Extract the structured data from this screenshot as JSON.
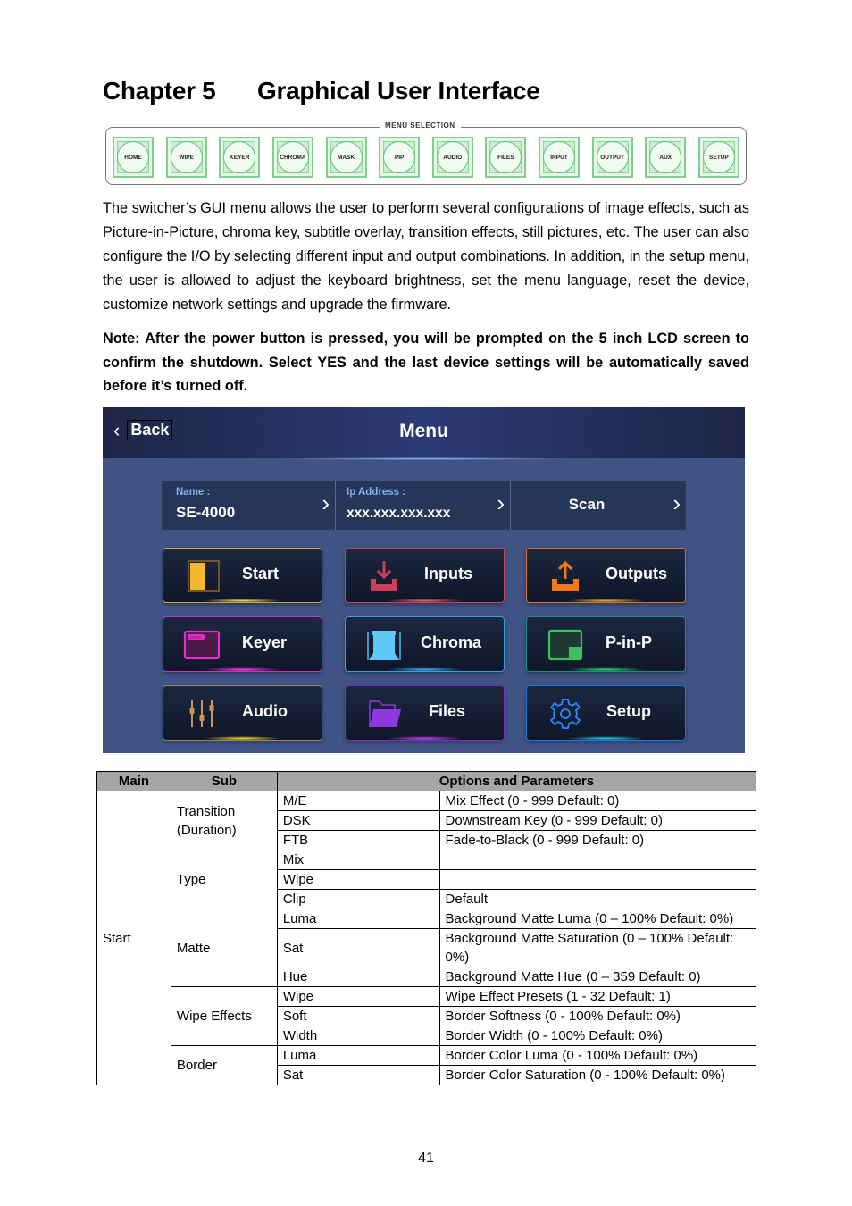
{
  "chapter": {
    "number": "Chapter 5",
    "title": "Graphical User Interface"
  },
  "menu_selection": {
    "label": "MENU SELECTION",
    "keys": [
      "HOME",
      "WIPE",
      "KEYER",
      "CHROMA",
      "MASK",
      "PIP",
      "AUDIO",
      "FILES",
      "INPUT",
      "OUTPUT",
      "AUX",
      "SETUP"
    ]
  },
  "body_text": "The switcher’s GUI menu allows the user to perform several configurations of image effects, such as Picture-in-Picture, chroma key, subtitle overlay, transition effects, still pictures, etc. The user can also configure the I/O by selecting different input and output combinations. In addition, in the setup menu, the user is allowed to adjust the keyboard brightness, set the menu language, reset the device, customize network settings and upgrade the firmware.",
  "note_text": "Note: After the power button is pressed, you will be prompted on the 5 inch LCD screen to confirm the shutdown. Select YES and the last device settings will be automatically saved before it’s turned off.",
  "gui": {
    "back_label": "Back",
    "title": "Menu",
    "name_label": "Name :",
    "name_value": "SE-4000",
    "ip_label": "Ip Address :",
    "ip_value": "xxx.xxx.xxx.xxx",
    "scan_label": "Scan",
    "tiles": [
      {
        "label": "Start",
        "icon": "start-icon",
        "color": "#d4a62a"
      },
      {
        "label": "Inputs",
        "icon": "download-icon",
        "color": "#d13e5c"
      },
      {
        "label": "Outputs",
        "icon": "upload-icon",
        "color": "#f07a1a"
      },
      {
        "label": "Keyer",
        "icon": "keyer-logo-icon",
        "color": "#e12fc8"
      },
      {
        "label": "Chroma",
        "icon": "chroma-backdrop-icon",
        "color": "#3aa8e0"
      },
      {
        "label": "P-in-P",
        "icon": "pip-icon",
        "color": "#1fa08a"
      },
      {
        "label": "Audio",
        "icon": "audio-faders-icon",
        "color": "#b08a5a"
      },
      {
        "label": "Files",
        "icon": "folder-icon",
        "color": "#8a32d8"
      },
      {
        "label": "Setup",
        "icon": "gear-icon",
        "color": "#1e86f0"
      }
    ],
    "keyer_logo_text": "LOGO"
  },
  "table": {
    "headers": [
      "Main",
      "Sub",
      "Options and Parameters"
    ],
    "main": "Start",
    "groups": [
      {
        "sub": "Transition (Duration)",
        "rows": [
          {
            "option": "M/E",
            "param": "Mix Effect (0 - 999 Default: 0)"
          },
          {
            "option": "DSK",
            "param": "Downstream Key (0 - 999 Default: 0)"
          },
          {
            "option": "FTB",
            "param": "Fade-to-Black (0 - 999 Default: 0)"
          }
        ]
      },
      {
        "sub": "Type",
        "rows": [
          {
            "option": "Mix",
            "param": ""
          },
          {
            "option": "Wipe",
            "param": ""
          },
          {
            "option": "Clip",
            "param": "Default"
          }
        ]
      },
      {
        "sub": "Matte",
        "rows": [
          {
            "option": "Luma",
            "param": "Background Matte Luma (0 – 100% Default: 0%)"
          },
          {
            "option": "Sat",
            "param": "Background Matte Saturation (0 – 100% Default: 0%)"
          },
          {
            "option": "Hue",
            "param": "Background Matte Hue (0 – 359 Default: 0)"
          }
        ]
      },
      {
        "sub": "Wipe Effects",
        "rows": [
          {
            "option": "Wipe",
            "param": "Wipe Effect Presets (1 - 32 Default: 1)"
          },
          {
            "option": "Soft",
            "param": "Border Softness (0 - 100% Default: 0%)"
          },
          {
            "option": "Width",
            "param": "Border Width (0 - 100% Default: 0%)"
          }
        ]
      },
      {
        "sub": "Border",
        "rows": [
          {
            "option": "Luma",
            "param": "Border Color Luma (0 - 100% Default: 0%)"
          },
          {
            "option": "Sat",
            "param": "Border Color Saturation (0 - 100% Default: 0%)"
          }
        ]
      }
    ]
  },
  "page_number": "41"
}
